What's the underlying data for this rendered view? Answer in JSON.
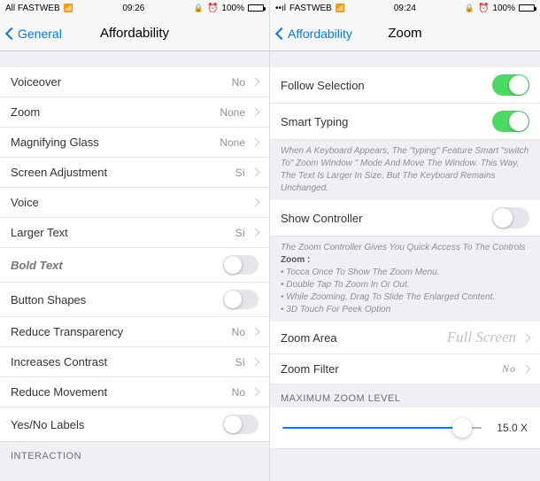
{
  "left": {
    "status": {
      "carrier": "All FASTWEB",
      "time": "09:26",
      "battery_pct": "100%"
    },
    "nav": {
      "back": "General",
      "title": "Affordability"
    },
    "rows": {
      "voiceover": {
        "label": "Voiceover",
        "value": "No"
      },
      "zoom": {
        "label": "Zoom",
        "value": "None"
      },
      "magnifying": {
        "label": "Magnifying Glass",
        "value": "None"
      },
      "screen_adjust": {
        "label": "Screen Adjustment",
        "value": "Sì"
      },
      "voice": {
        "label": "Voice"
      },
      "larger_text": {
        "label": "Larger Text",
        "value": "Sì"
      },
      "bold_text": {
        "label": "Bold Text",
        "toggle": false
      },
      "button_shapes": {
        "label": "Button Shapes",
        "toggle": false
      },
      "reduce_transparency": {
        "label": "Reduce Transparency",
        "value": "No"
      },
      "increases_contrast": {
        "label": "Increases Contrast",
        "value": "Sì"
      },
      "reduce_movement": {
        "label": "Reduce Movement",
        "value": "No"
      },
      "yes_no_labels": {
        "label": "Yes/No Labels",
        "toggle": false
      }
    },
    "section_interaction": "INTERACTION"
  },
  "right": {
    "status": {
      "carrier": "FASTWEB",
      "time": "09:24",
      "battery_pct": "100%"
    },
    "nav": {
      "back": "Affordability",
      "title": "Zoom"
    },
    "rows": {
      "follow_selection": {
        "label": "Follow Selection",
        "toggle": true
      },
      "smart_typing": {
        "label": "Smart Typing",
        "toggle": true
      },
      "smart_typing_hint": "When A Keyboard Appears, The \"typing\" Feature Smart \"switch To\" Zoom Window \" Mode And Move The Window. This Way, The Text Is Larger In Size, But The Keyboard Remains Unchanged.",
      "show_controller": {
        "label": "Show Controller",
        "toggle": false
      },
      "controller_hint": {
        "lead": "The Zoom Controller Gives You Quick Access To The Controls",
        "title": "Zoom :",
        "b1": "• Tocca Once To Show The Zoom Menu.",
        "b2": "• Double Tap To Zoom In Or Out.",
        "b3": "• While Zooming, Drag To Slide The Enlarged Content.",
        "b4": "• 3D Touch For Peek Option"
      },
      "zoom_area": {
        "label": "Zoom Area",
        "value": "Full Screen"
      },
      "zoom_filter": {
        "label": "Zoom Filter",
        "value": "No"
      },
      "max_zoom_header": "MAXIMUM ZOOM LEVEL",
      "max_zoom_value": "15.0 X"
    }
  }
}
